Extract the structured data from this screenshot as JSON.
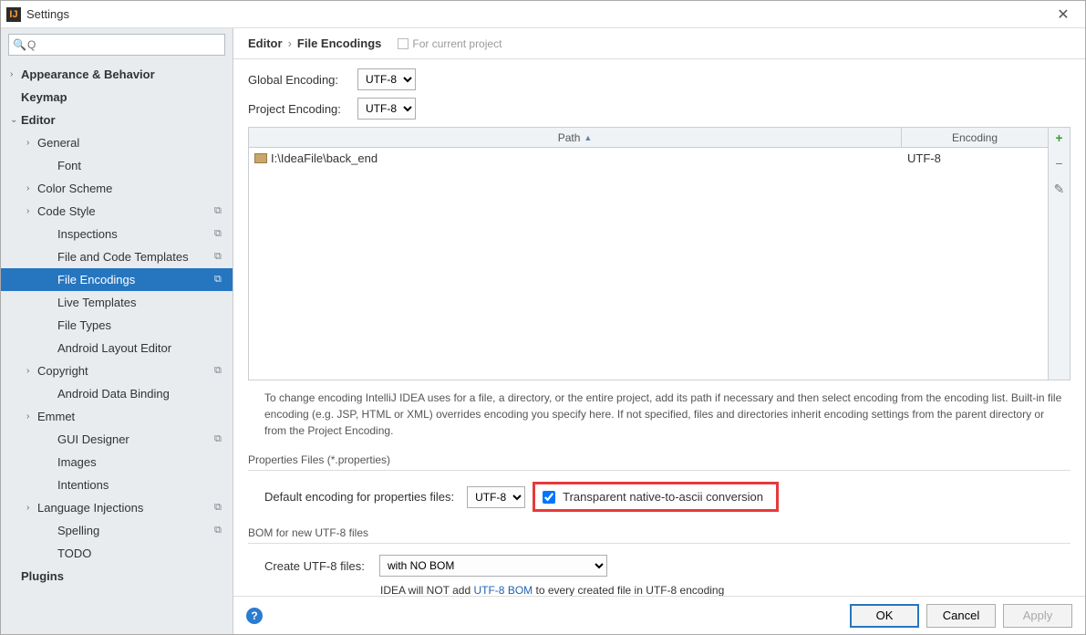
{
  "window": {
    "title": "Settings"
  },
  "search": {
    "placeholder": "Q"
  },
  "tree": {
    "items": [
      {
        "label": "Appearance & Behavior",
        "depth": 0,
        "arrow": "›",
        "badge": ""
      },
      {
        "label": "Keymap",
        "depth": 0,
        "arrow": "",
        "badge": ""
      },
      {
        "label": "Editor",
        "depth": 0,
        "arrow": "⌄",
        "badge": ""
      },
      {
        "label": "General",
        "depth": 1,
        "arrow": "›",
        "badge": ""
      },
      {
        "label": "Font",
        "depth": 2,
        "arrow": "",
        "badge": ""
      },
      {
        "label": "Color Scheme",
        "depth": 1,
        "arrow": "›",
        "badge": ""
      },
      {
        "label": "Code Style",
        "depth": 1,
        "arrow": "›",
        "badge": "⧉"
      },
      {
        "label": "Inspections",
        "depth": 2,
        "arrow": "",
        "badge": "⧉"
      },
      {
        "label": "File and Code Templates",
        "depth": 2,
        "arrow": "",
        "badge": "⧉"
      },
      {
        "label": "File Encodings",
        "depth": 2,
        "arrow": "",
        "badge": "⧉",
        "selected": true
      },
      {
        "label": "Live Templates",
        "depth": 2,
        "arrow": "",
        "badge": ""
      },
      {
        "label": "File Types",
        "depth": 2,
        "arrow": "",
        "badge": ""
      },
      {
        "label": "Android Layout Editor",
        "depth": 2,
        "arrow": "",
        "badge": ""
      },
      {
        "label": "Copyright",
        "depth": 1,
        "arrow": "›",
        "badge": "⧉"
      },
      {
        "label": "Android Data Binding",
        "depth": 2,
        "arrow": "",
        "badge": ""
      },
      {
        "label": "Emmet",
        "depth": 1,
        "arrow": "›",
        "badge": ""
      },
      {
        "label": "GUI Designer",
        "depth": 2,
        "arrow": "",
        "badge": "⧉"
      },
      {
        "label": "Images",
        "depth": 2,
        "arrow": "",
        "badge": ""
      },
      {
        "label": "Intentions",
        "depth": 2,
        "arrow": "",
        "badge": ""
      },
      {
        "label": "Language Injections",
        "depth": 1,
        "arrow": "›",
        "badge": "⧉"
      },
      {
        "label": "Spelling",
        "depth": 2,
        "arrow": "",
        "badge": "⧉"
      },
      {
        "label": "TODO",
        "depth": 2,
        "arrow": "",
        "badge": ""
      },
      {
        "label": "Plugins",
        "depth": 0,
        "arrow": "",
        "badge": ""
      }
    ]
  },
  "breadcrumb": {
    "a": "Editor",
    "b": "File Encodings",
    "hint": "For current project"
  },
  "global": {
    "label": "Global Encoding:",
    "value": "UTF-8"
  },
  "project": {
    "label": "Project Encoding:",
    "value": "UTF-8"
  },
  "table": {
    "col_path": "Path",
    "col_enc": "Encoding",
    "rows": [
      {
        "path": "I:\\IdeaFile\\back_end",
        "encoding": "UTF-8"
      }
    ]
  },
  "desc": "To change encoding IntelliJ IDEA uses for a file, a directory, or the entire project, add its path if necessary and then select encoding from the encoding list. Built-in file encoding (e.g. JSP, HTML or XML) overrides encoding you specify here. If not specified, files and directories inherit encoding settings from the parent directory or from the Project Encoding.",
  "props": {
    "section": "Properties Files (*.properties)",
    "label": "Default encoding for properties files:",
    "value": "UTF-8",
    "chk_label": "Transparent native-to-ascii conversion"
  },
  "bom": {
    "section": "BOM for new UTF-8 files",
    "label": "Create UTF-8 files:",
    "value": "with NO BOM",
    "note_pre": "IDEA will NOT add ",
    "note_link": "UTF-8 BOM",
    "note_post": " to every created file in UTF-8 encoding"
  },
  "buttons": {
    "ok": "OK",
    "cancel": "Cancel",
    "apply": "Apply"
  }
}
